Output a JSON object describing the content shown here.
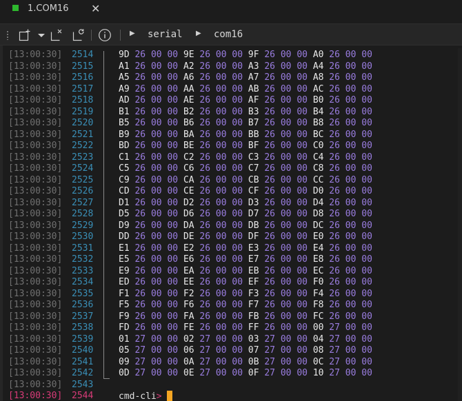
{
  "tab": {
    "label": "1.COM16",
    "close_glyph": "✕",
    "status_color": "#2eb82e"
  },
  "toolbar": {
    "icons": [
      "new-window-icon",
      "dropdown-chevron-icon",
      "close-session-icon",
      "reconnect-icon",
      "info-icon"
    ],
    "breadcrumb": [
      "serial",
      "com16"
    ]
  },
  "terminal": {
    "lines": [
      {
        "ts": "[13:00:30]",
        "n": "2514",
        "bytes": [
          "9D",
          "26",
          "00",
          "00",
          "9E",
          "26",
          "00",
          "00",
          "9F",
          "26",
          "00",
          "00",
          "A0",
          "26",
          "00",
          "00"
        ]
      },
      {
        "ts": "[13:00:30]",
        "n": "2515",
        "bytes": [
          "A1",
          "26",
          "00",
          "00",
          "A2",
          "26",
          "00",
          "00",
          "A3",
          "26",
          "00",
          "00",
          "A4",
          "26",
          "00",
          "00"
        ]
      },
      {
        "ts": "[13:00:30]",
        "n": "2516",
        "bytes": [
          "A5",
          "26",
          "00",
          "00",
          "A6",
          "26",
          "00",
          "00",
          "A7",
          "26",
          "00",
          "00",
          "A8",
          "26",
          "00",
          "00"
        ]
      },
      {
        "ts": "[13:00:30]",
        "n": "2517",
        "bytes": [
          "A9",
          "26",
          "00",
          "00",
          "AA",
          "26",
          "00",
          "00",
          "AB",
          "26",
          "00",
          "00",
          "AC",
          "26",
          "00",
          "00"
        ]
      },
      {
        "ts": "[13:00:30]",
        "n": "2518",
        "bytes": [
          "AD",
          "26",
          "00",
          "00",
          "AE",
          "26",
          "00",
          "00",
          "AF",
          "26",
          "00",
          "00",
          "B0",
          "26",
          "00",
          "00"
        ]
      },
      {
        "ts": "[13:00:30]",
        "n": "2519",
        "bytes": [
          "B1",
          "26",
          "00",
          "00",
          "B2",
          "26",
          "00",
          "00",
          "B3",
          "26",
          "00",
          "00",
          "B4",
          "26",
          "00",
          "00"
        ]
      },
      {
        "ts": "[13:00:30]",
        "n": "2520",
        "bytes": [
          "B5",
          "26",
          "00",
          "00",
          "B6",
          "26",
          "00",
          "00",
          "B7",
          "26",
          "00",
          "00",
          "B8",
          "26",
          "00",
          "00"
        ]
      },
      {
        "ts": "[13:00:30]",
        "n": "2521",
        "bytes": [
          "B9",
          "26",
          "00",
          "00",
          "BA",
          "26",
          "00",
          "00",
          "BB",
          "26",
          "00",
          "00",
          "BC",
          "26",
          "00",
          "00"
        ]
      },
      {
        "ts": "[13:00:30]",
        "n": "2522",
        "bytes": [
          "BD",
          "26",
          "00",
          "00",
          "BE",
          "26",
          "00",
          "00",
          "BF",
          "26",
          "00",
          "00",
          "C0",
          "26",
          "00",
          "00"
        ]
      },
      {
        "ts": "[13:00:30]",
        "n": "2523",
        "bytes": [
          "C1",
          "26",
          "00",
          "00",
          "C2",
          "26",
          "00",
          "00",
          "C3",
          "26",
          "00",
          "00",
          "C4",
          "26",
          "00",
          "00"
        ]
      },
      {
        "ts": "[13:00:30]",
        "n": "2524",
        "bytes": [
          "C5",
          "26",
          "00",
          "00",
          "C6",
          "26",
          "00",
          "00",
          "C7",
          "26",
          "00",
          "00",
          "C8",
          "26",
          "00",
          "00"
        ]
      },
      {
        "ts": "[13:00:30]",
        "n": "2525",
        "bytes": [
          "C9",
          "26",
          "00",
          "00",
          "CA",
          "26",
          "00",
          "00",
          "CB",
          "26",
          "00",
          "00",
          "CC",
          "26",
          "00",
          "00"
        ]
      },
      {
        "ts": "[13:00:30]",
        "n": "2526",
        "bytes": [
          "CD",
          "26",
          "00",
          "00",
          "CE",
          "26",
          "00",
          "00",
          "CF",
          "26",
          "00",
          "00",
          "D0",
          "26",
          "00",
          "00"
        ]
      },
      {
        "ts": "[13:00:30]",
        "n": "2527",
        "bytes": [
          "D1",
          "26",
          "00",
          "00",
          "D2",
          "26",
          "00",
          "00",
          "D3",
          "26",
          "00",
          "00",
          "D4",
          "26",
          "00",
          "00"
        ]
      },
      {
        "ts": "[13:00:30]",
        "n": "2528",
        "bytes": [
          "D5",
          "26",
          "00",
          "00",
          "D6",
          "26",
          "00",
          "00",
          "D7",
          "26",
          "00",
          "00",
          "D8",
          "26",
          "00",
          "00"
        ]
      },
      {
        "ts": "[13:00:30]",
        "n": "2529",
        "bytes": [
          "D9",
          "26",
          "00",
          "00",
          "DA",
          "26",
          "00",
          "00",
          "DB",
          "26",
          "00",
          "00",
          "DC",
          "26",
          "00",
          "00"
        ]
      },
      {
        "ts": "[13:00:30]",
        "n": "2530",
        "bytes": [
          "DD",
          "26",
          "00",
          "00",
          "DE",
          "26",
          "00",
          "00",
          "DF",
          "26",
          "00",
          "00",
          "E0",
          "26",
          "00",
          "00"
        ]
      },
      {
        "ts": "[13:00:30]",
        "n": "2531",
        "bytes": [
          "E1",
          "26",
          "00",
          "00",
          "E2",
          "26",
          "00",
          "00",
          "E3",
          "26",
          "00",
          "00",
          "E4",
          "26",
          "00",
          "00"
        ]
      },
      {
        "ts": "[13:00:30]",
        "n": "2532",
        "bytes": [
          "E5",
          "26",
          "00",
          "00",
          "E6",
          "26",
          "00",
          "00",
          "E7",
          "26",
          "00",
          "00",
          "E8",
          "26",
          "00",
          "00"
        ]
      },
      {
        "ts": "[13:00:30]",
        "n": "2533",
        "bytes": [
          "E9",
          "26",
          "00",
          "00",
          "EA",
          "26",
          "00",
          "00",
          "EB",
          "26",
          "00",
          "00",
          "EC",
          "26",
          "00",
          "00"
        ]
      },
      {
        "ts": "[13:00:30]",
        "n": "2534",
        "bytes": [
          "ED",
          "26",
          "00",
          "00",
          "EE",
          "26",
          "00",
          "00",
          "EF",
          "26",
          "00",
          "00",
          "F0",
          "26",
          "00",
          "00"
        ]
      },
      {
        "ts": "[13:00:30]",
        "n": "2535",
        "bytes": [
          "F1",
          "26",
          "00",
          "00",
          "F2",
          "26",
          "00",
          "00",
          "F3",
          "26",
          "00",
          "00",
          "F4",
          "26",
          "00",
          "00"
        ]
      },
      {
        "ts": "[13:00:30]",
        "n": "2536",
        "bytes": [
          "F5",
          "26",
          "00",
          "00",
          "F6",
          "26",
          "00",
          "00",
          "F7",
          "26",
          "00",
          "00",
          "F8",
          "26",
          "00",
          "00"
        ]
      },
      {
        "ts": "[13:00:30]",
        "n": "2537",
        "bytes": [
          "F9",
          "26",
          "00",
          "00",
          "FA",
          "26",
          "00",
          "00",
          "FB",
          "26",
          "00",
          "00",
          "FC",
          "26",
          "00",
          "00"
        ]
      },
      {
        "ts": "[13:00:30]",
        "n": "2538",
        "bytes": [
          "FD",
          "26",
          "00",
          "00",
          "FE",
          "26",
          "00",
          "00",
          "FF",
          "26",
          "00",
          "00",
          "00",
          "27",
          "00",
          "00"
        ]
      },
      {
        "ts": "[13:00:30]",
        "n": "2539",
        "bytes": [
          "01",
          "27",
          "00",
          "00",
          "02",
          "27",
          "00",
          "00",
          "03",
          "27",
          "00",
          "00",
          "04",
          "27",
          "00",
          "00"
        ]
      },
      {
        "ts": "[13:00:30]",
        "n": "2540",
        "bytes": [
          "05",
          "27",
          "00",
          "00",
          "06",
          "27",
          "00",
          "00",
          "07",
          "27",
          "00",
          "00",
          "08",
          "27",
          "00",
          "00"
        ]
      },
      {
        "ts": "[13:00:30]",
        "n": "2541",
        "bytes": [
          "09",
          "27",
          "00",
          "00",
          "0A",
          "27",
          "00",
          "00",
          "0B",
          "27",
          "00",
          "00",
          "0C",
          "27",
          "00",
          "00"
        ]
      },
      {
        "ts": "[13:00:30]",
        "n": "2542",
        "bytes": [
          "0D",
          "27",
          "00",
          "00",
          "0E",
          "27",
          "00",
          "00",
          "0F",
          "27",
          "00",
          "00",
          "10",
          "27",
          "00",
          "00"
        ]
      },
      {
        "ts": "[13:00:30]",
        "n": "2543",
        "bytes": []
      }
    ],
    "prompt": {
      "ts": "[13:00:30]",
      "n": "2544",
      "text": "cmd-cli",
      "caret": ">"
    }
  },
  "colors": {
    "timestamp": "#707070",
    "line_number": "#3a8fb7",
    "active": "#d83b78",
    "byte_primary": "#e8e8e8",
    "byte_secondary": "#9a7de0",
    "cursor": "#f5a623"
  }
}
